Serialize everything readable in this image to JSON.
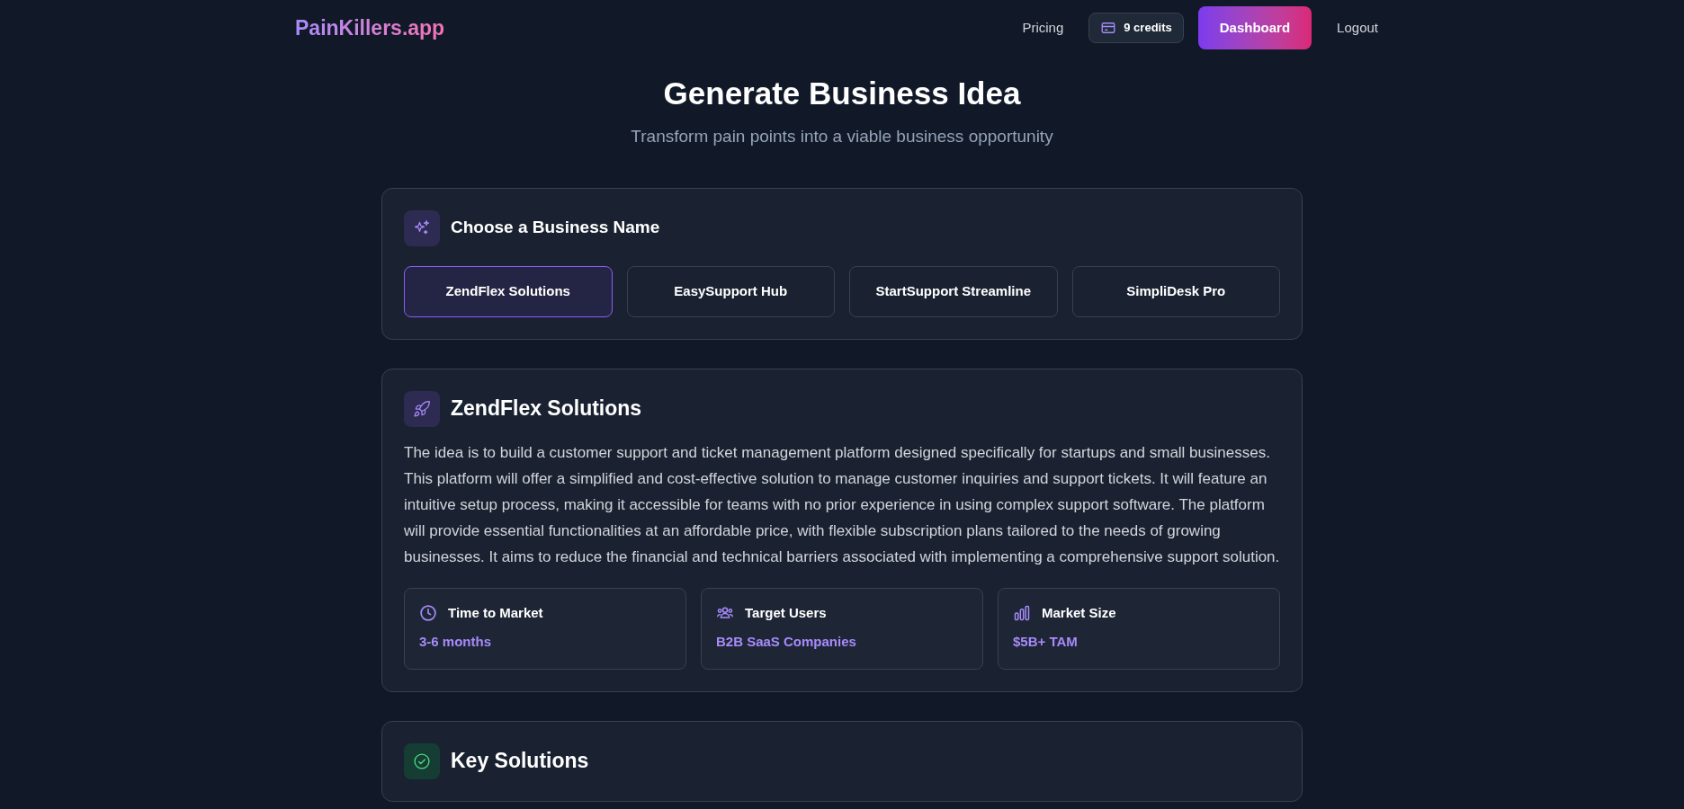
{
  "header": {
    "logo": "PainKillers.app",
    "nav": [
      {
        "kind": "link",
        "label": "Pricing"
      },
      {
        "kind": "credits",
        "label": "9 credits"
      },
      {
        "kind": "primary",
        "label": "Dashboard"
      },
      {
        "kind": "link",
        "label": "Logout"
      }
    ]
  },
  "page": {
    "title": "Generate Business Idea",
    "subtitle": "Transform pain points into a viable business opportunity"
  },
  "name_picker": {
    "title": "Choose a Business Name",
    "options": [
      {
        "label": "ZendFlex Solutions",
        "selected": true
      },
      {
        "label": "EasySupport Hub",
        "selected": false
      },
      {
        "label": "StartSupport Streamline",
        "selected": false
      },
      {
        "label": "SimpliDesk Pro",
        "selected": false
      }
    ]
  },
  "idea": {
    "title": "ZendFlex Solutions",
    "description": "The idea is to build a customer support and ticket management platform designed specifically for startups and small businesses. This platform will offer a simplified and cost-effective solution to manage customer inquiries and support tickets. It will feature an intuitive setup process, making it accessible for teams with no prior experience in using complex support software. The platform will provide essential functionalities at an affordable price, with flexible subscription plans tailored to the needs of growing businesses. It aims to reduce the financial and technical barriers associated with implementing a comprehensive support solution.",
    "stats": [
      {
        "kind": "time",
        "label": "Time to Market",
        "value": "3-6 months"
      },
      {
        "kind": "users",
        "label": "Target Users",
        "value": "B2B SaaS Companies"
      },
      {
        "kind": "market",
        "label": "Market Size",
        "value": "$5B+ TAM"
      }
    ]
  },
  "key_solutions": {
    "title": "Key Solutions"
  }
}
